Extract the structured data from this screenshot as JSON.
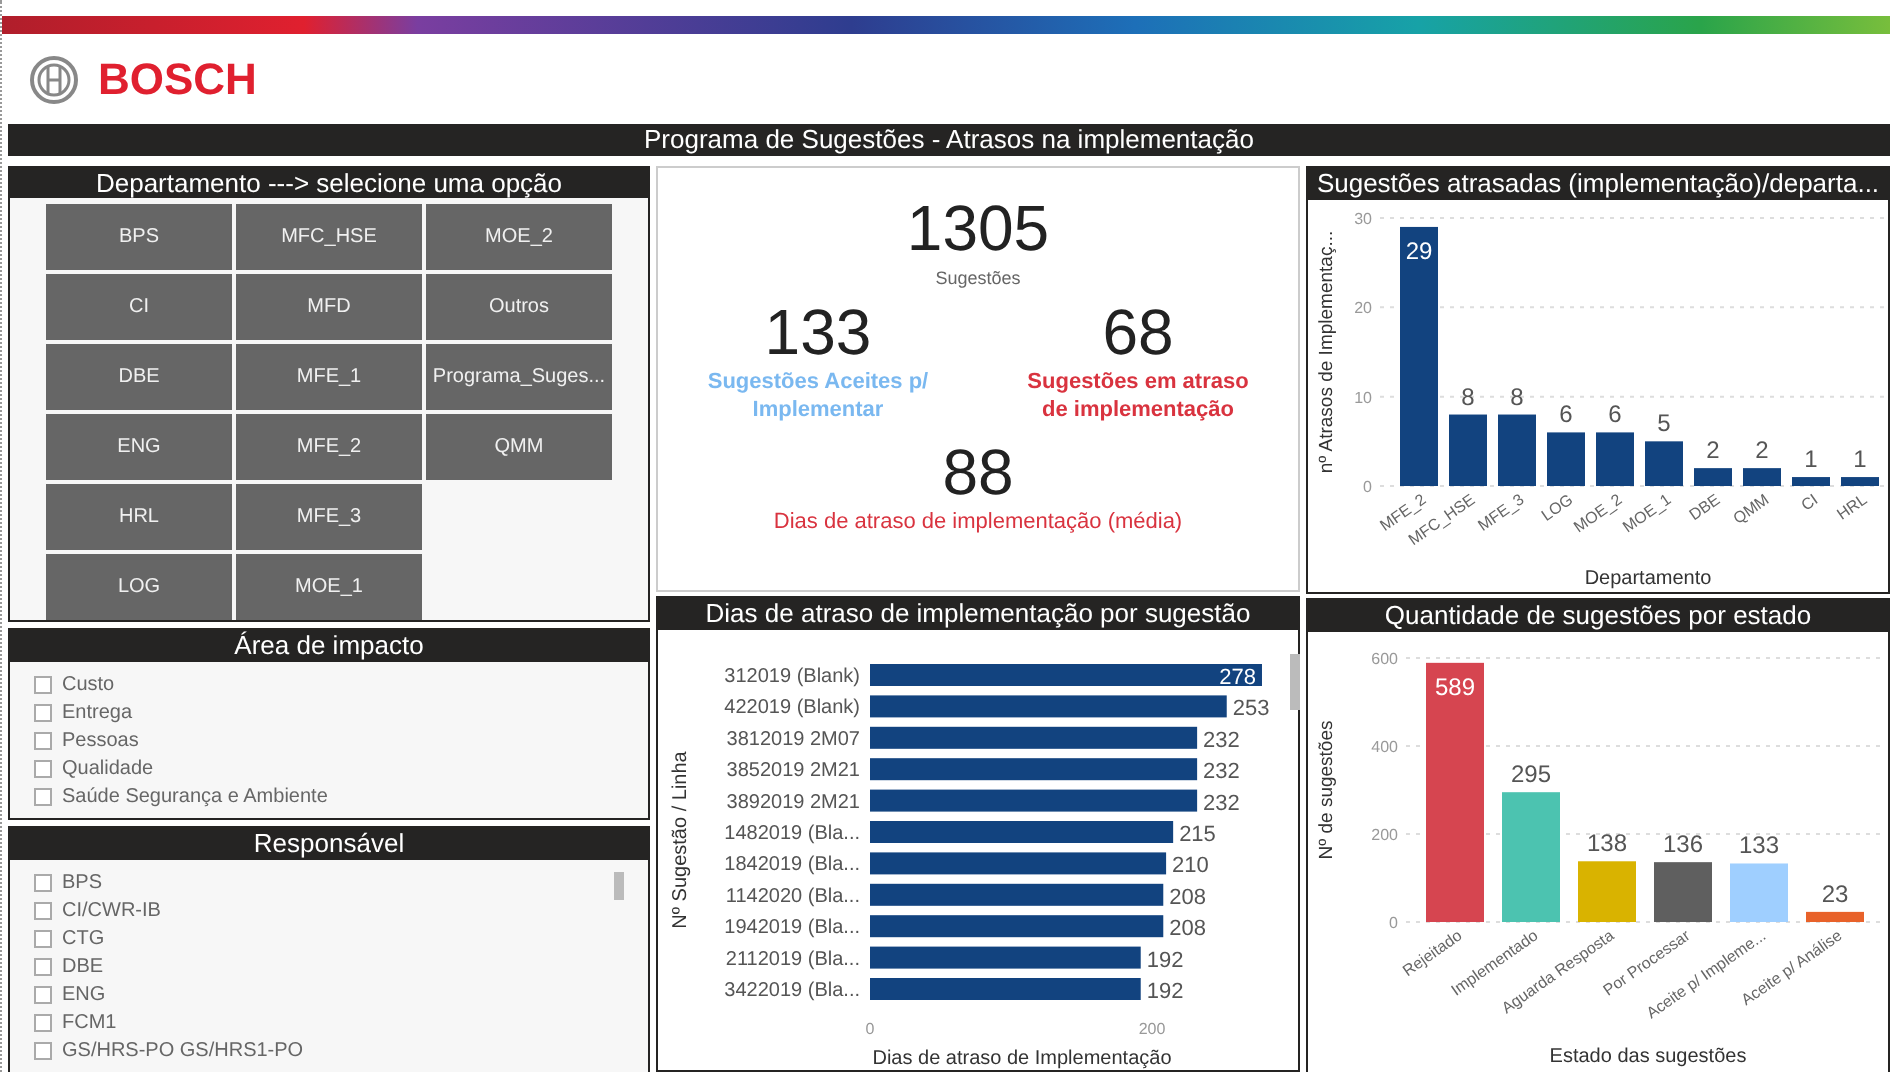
{
  "brand": {
    "name": "BOSCH"
  },
  "title": "Programa de Sugestões - Atrasos na implementação",
  "departments": {
    "title": "Departamento ---> selecione uma opção",
    "buttons": [
      {
        "label": "BPS",
        "selected": false
      },
      {
        "label": "CI",
        "selected": false
      },
      {
        "label": "DBE",
        "selected": false
      },
      {
        "label": "ENG",
        "selected": false
      },
      {
        "label": "HRL",
        "selected": false
      },
      {
        "label": "LOG",
        "selected": false
      },
      {
        "label": "MFC_HSE",
        "selected": false
      },
      {
        "label": "MFD",
        "selected": false
      },
      {
        "label": "MFE_1",
        "selected": false
      },
      {
        "label": "MFE_2",
        "selected": false
      },
      {
        "label": "MFE_3",
        "selected": false
      },
      {
        "label": "MOE_1",
        "selected": false
      },
      {
        "label": "MOE_2",
        "selected": false
      },
      {
        "label": "Outros",
        "selected": false
      },
      {
        "label": "Programa_Suges...",
        "selected": false
      },
      {
        "label": "QMM",
        "selected": false
      }
    ]
  },
  "impact_area": {
    "title": "Área de impacto",
    "items": [
      {
        "label": "Custo",
        "checked": false
      },
      {
        "label": "Entrega",
        "checked": false
      },
      {
        "label": "Pessoas",
        "checked": false
      },
      {
        "label": "Qualidade",
        "checked": false
      },
      {
        "label": "Saúde Segurança e Ambiente",
        "checked": false
      }
    ]
  },
  "responsible": {
    "title": "Responsável",
    "items": [
      {
        "label": "BPS",
        "checked": false
      },
      {
        "label": "CI/CWR-IB",
        "checked": false
      },
      {
        "label": "CTG",
        "checked": false
      },
      {
        "label": "DBE",
        "checked": false
      },
      {
        "label": "ENG",
        "checked": false
      },
      {
        "label": "FCM1",
        "checked": false
      },
      {
        "label": "GS/HRS-PO GS/HRS1-PO",
        "checked": false
      }
    ]
  },
  "kpis": [
    {
      "kind": "total",
      "value": "1305",
      "label": "Sugestões"
    },
    {
      "kind": "accepted",
      "value": "133",
      "label": "Sugestões Aceites p/ Implementar"
    },
    {
      "kind": "late",
      "value": "68",
      "label": "Sugestões em atraso de implementação"
    },
    {
      "kind": "average",
      "value": "88",
      "label": "Dias de atraso de implementação (média)"
    }
  ],
  "delay_chart": {
    "title": "Dias de atraso de implementação por sugestão",
    "chart_data": {
      "type": "bar",
      "orientation": "horizontal",
      "xlabel": "Dias de atraso de Implementação",
      "ylabel": "Nº Sugestão / Linha",
      "categories": [
        "312019 (Blank)",
        "422019 (Blank)",
        "3812019 2M07",
        "3852019 2M21",
        "3892019 2M21",
        "1482019 (Bla...",
        "1842019 (Bla...",
        "1142020 (Bla...",
        "1942019 (Bla...",
        "2112019 (Bla...",
        "3422019 (Bla..."
      ],
      "series": [
        {
          "color": "#12437f",
          "values": [
            278,
            253,
            232,
            232,
            232,
            215,
            210,
            208,
            208,
            192,
            192
          ]
        }
      ],
      "xlim": [
        0,
        300
      ],
      "xticks": [
        0,
        200
      ],
      "data_labels": true
    }
  },
  "dept_chart": {
    "title": "Sugestões atrasadas (implementação)/departa...",
    "chart_data": {
      "type": "bar",
      "xlabel": "Departamento",
      "ylabel": "nº Atrasos de Implementaç...",
      "categories": [
        "MFE_2",
        "MFC_HSE",
        "MFE_3",
        "LOG",
        "MOE_2",
        "MOE_1",
        "DBE",
        "QMM",
        "CI",
        "HRL"
      ],
      "series": [
        {
          "color": "#12437f",
          "values": [
            29,
            8,
            8,
            6,
            6,
            5,
            2,
            2,
            1,
            1
          ]
        }
      ],
      "ylim": [
        0,
        30
      ],
      "yticks": [
        0,
        10,
        20,
        30
      ],
      "data_labels": true
    }
  },
  "state_chart": {
    "title": "Quantidade de sugestões por estado",
    "chart_data": {
      "type": "bar",
      "xlabel": "Estado das sugestões",
      "ylabel": "Nº de sugestões",
      "categories": [
        "Rejeitado",
        "Implementado",
        "Aguarda Resposta",
        "Por Processar",
        "Aceite p/ Impleme...",
        "Aceite p/ Análise"
      ],
      "series": [
        {
          "colors": [
            "#d64550",
            "#4cc3b0",
            "#d9b300",
            "#5f5f5f",
            "#9fcfff",
            "#e8622a"
          ],
          "values": [
            589,
            295,
            138,
            136,
            133,
            23
          ]
        }
      ],
      "ylim": [
        0,
        600
      ],
      "yticks": [
        0,
        200,
        400,
        600
      ],
      "data_labels": true
    }
  }
}
